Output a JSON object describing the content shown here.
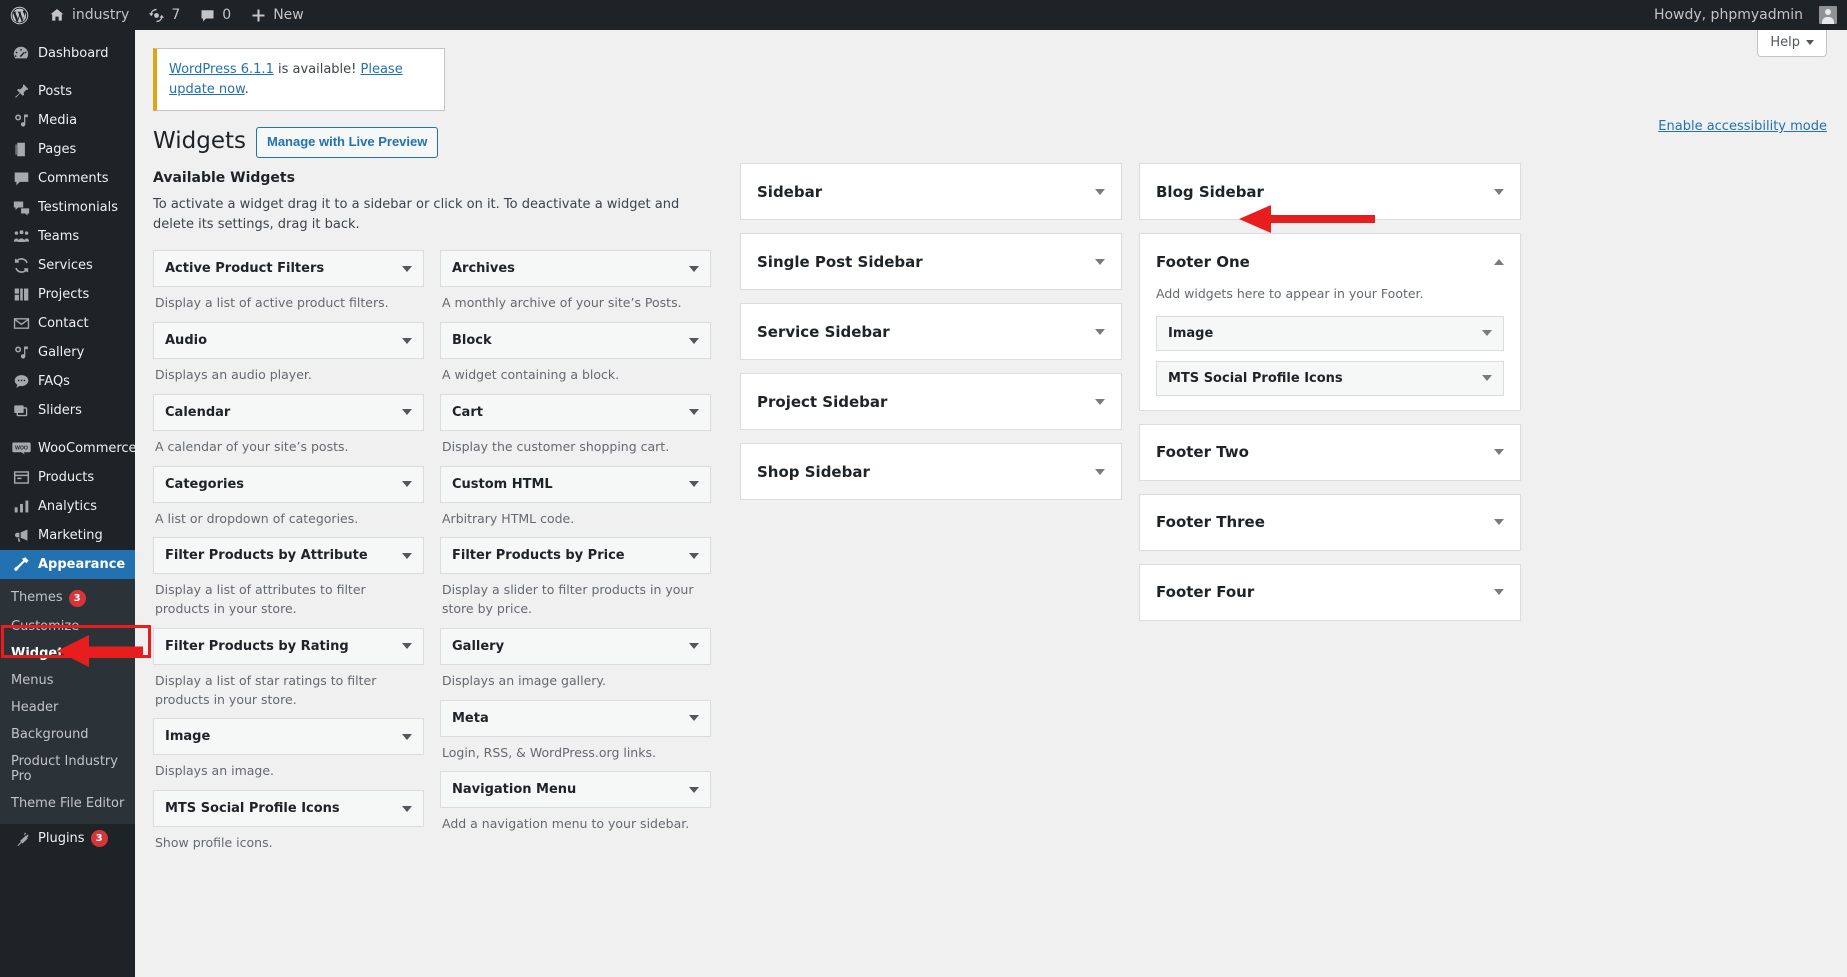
{
  "adminbar": {
    "logo_icon": "wordpress-logo-icon",
    "site_name": "industry",
    "home_icon": "home-icon",
    "updates_icon": "updates-icon",
    "updates_count": "7",
    "comments_icon": "comments-icon",
    "comments_count": "0",
    "new_icon": "plus-icon",
    "new_label": "New",
    "howdy": "Howdy, phpmyadmin",
    "avatar": "user-avatar"
  },
  "sidebar": {
    "items": [
      {
        "label": "Dashboard",
        "icon": "dashboard-icon"
      },
      {
        "label": "Posts",
        "icon": "pin-icon"
      },
      {
        "label": "Media",
        "icon": "media-icon"
      },
      {
        "label": "Pages",
        "icon": "pages-icon"
      },
      {
        "label": "Comments",
        "icon": "comments-icon"
      },
      {
        "label": "Testimonials",
        "icon": "testimonials-icon"
      },
      {
        "label": "Teams",
        "icon": "teams-icon"
      },
      {
        "label": "Services",
        "icon": "services-icon"
      },
      {
        "label": "Projects",
        "icon": "projects-icon"
      },
      {
        "label": "Contact",
        "icon": "envelope-icon"
      },
      {
        "label": "Gallery",
        "icon": "gallery-icon"
      },
      {
        "label": "FAQs",
        "icon": "faq-icon"
      },
      {
        "label": "Sliders",
        "icon": "sliders-icon"
      },
      {
        "label": "WooCommerce",
        "icon": "woocommerce-icon"
      },
      {
        "label": "Products",
        "icon": "products-icon"
      },
      {
        "label": "Analytics",
        "icon": "analytics-icon"
      },
      {
        "label": "Marketing",
        "icon": "marketing-icon"
      },
      {
        "label": "Appearance",
        "icon": "appearance-icon",
        "current": true
      },
      {
        "label": "Plugins",
        "icon": "plugins-icon",
        "badge": "3"
      }
    ],
    "appearance_submenu": [
      {
        "label": "Themes",
        "badge": "3"
      },
      {
        "label": "Customize"
      },
      {
        "label": "Widgets",
        "current": true
      },
      {
        "label": "Menus"
      },
      {
        "label": "Header"
      },
      {
        "label": "Background"
      },
      {
        "label": "Product Industry Pro"
      },
      {
        "label": "Theme File Editor"
      }
    ]
  },
  "toolbar": {
    "help_label": "Help",
    "accessibility_link": "Enable accessibility mode"
  },
  "notice": {
    "link_version": "WordPress 6.1.1",
    "text_mid": " is available! ",
    "link_update": "Please update now",
    "text_end": "."
  },
  "header": {
    "page_title": "Widgets",
    "live_preview_label": "Manage with Live Preview"
  },
  "available": {
    "heading": "Available Widgets",
    "description": "To activate a widget drag it to a sidebar or click on it. To deactivate a widget and delete its settings, drag it back.",
    "left_column": [
      {
        "name": "Active Product Filters",
        "desc": "Display a list of active product filters."
      },
      {
        "name": "Audio",
        "desc": "Displays an audio player."
      },
      {
        "name": "Calendar",
        "desc": "A calendar of your site’s posts."
      },
      {
        "name": "Categories",
        "desc": "A list or dropdown of categories."
      },
      {
        "name": "Filter Products by Attribute",
        "desc": "Display a list of attributes to filter products in your store."
      },
      {
        "name": "Filter Products by Rating",
        "desc": "Display a list of star ratings to filter products in your store."
      },
      {
        "name": "Image",
        "desc": "Displays an image."
      },
      {
        "name": "MTS Social Profile Icons",
        "desc": "Show profile icons."
      }
    ],
    "right_column": [
      {
        "name": "Archives",
        "desc": "A monthly archive of your site’s Posts."
      },
      {
        "name": "Block",
        "desc": "A widget containing a block."
      },
      {
        "name": "Cart",
        "desc": "Display the customer shopping cart."
      },
      {
        "name": "Custom HTML",
        "desc": "Arbitrary HTML code."
      },
      {
        "name": "Filter Products by Price",
        "desc": "Display a slider to filter products in your store by price."
      },
      {
        "name": "Gallery",
        "desc": "Displays an image gallery."
      },
      {
        "name": "Meta",
        "desc": "Login, RSS, & WordPress.org links."
      },
      {
        "name": "Navigation Menu",
        "desc": "Add a navigation menu to your sidebar."
      }
    ]
  },
  "sidebars_col1": [
    {
      "title": "Sidebar",
      "expanded": false
    },
    {
      "title": "Single Post Sidebar",
      "expanded": false
    },
    {
      "title": "Service Sidebar",
      "expanded": false
    },
    {
      "title": "Project Sidebar",
      "expanded": false
    },
    {
      "title": "Shop Sidebar",
      "expanded": false
    }
  ],
  "sidebars_col2": [
    {
      "title": "Blog Sidebar",
      "expanded": false
    },
    {
      "title": "Footer One",
      "expanded": true,
      "description": "Add widgets here to appear in your Footer.",
      "widgets": [
        "Image",
        "MTS Social Profile Icons"
      ]
    },
    {
      "title": "Footer Two",
      "expanded": false
    },
    {
      "title": "Footer Three",
      "expanded": false
    },
    {
      "title": "Footer Four",
      "expanded": false
    }
  ],
  "annotations": {
    "highlight_color": "#e81e1e",
    "box_target": "Appearance",
    "arrow_widgets_target": "Widgets",
    "arrow_footer_target": "Footer One"
  }
}
